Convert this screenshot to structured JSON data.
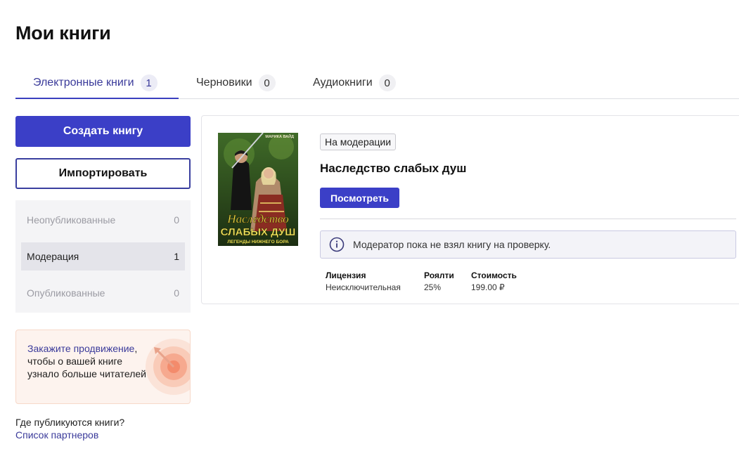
{
  "page": {
    "title": "Мои книги"
  },
  "tabs": [
    {
      "label": "Электронные книги",
      "count": "1",
      "active": true
    },
    {
      "label": "Черновики",
      "count": "0",
      "active": false
    },
    {
      "label": "Аудиокниги",
      "count": "0",
      "active": false
    }
  ],
  "actions": {
    "create_label": "Создать книгу",
    "import_label": "Импортировать"
  },
  "filters": [
    {
      "label": "Неопубликованные",
      "count": "0",
      "selected": false
    },
    {
      "label": "Модерация",
      "count": "1",
      "selected": true
    },
    {
      "label": "Опубликованные",
      "count": "0",
      "selected": false
    }
  ],
  "promo": {
    "link_text": "Закажите продвижение",
    "rest_text": ", чтобы о вашей книге узнало больше читателей"
  },
  "help": {
    "question": "Где публикуются книги?",
    "link": "Список партнеров"
  },
  "book": {
    "status": "На модерации",
    "title": "Наследство слабых душ",
    "view_label": "Посмотреть",
    "info": "Модератор пока не взял книгу на проверку.",
    "cover": {
      "author": "МАРИКА ВАЙД",
      "title_line1": "Наследство",
      "title_line2": "СЛАБЫХ ДУШ",
      "series": "ЛЕГЕНДЫ НИЖНЕГО БОРА"
    },
    "meta": [
      {
        "label": "Лицензия",
        "value": "Неисключительная"
      },
      {
        "label": "Роялти",
        "value": "25%"
      },
      {
        "label": "Стоимость",
        "value": "199.00 ₽"
      }
    ]
  },
  "colors": {
    "accent": "#3b3fc7",
    "link": "#3a3a9a",
    "promo_bg": "#fdf3ee"
  }
}
